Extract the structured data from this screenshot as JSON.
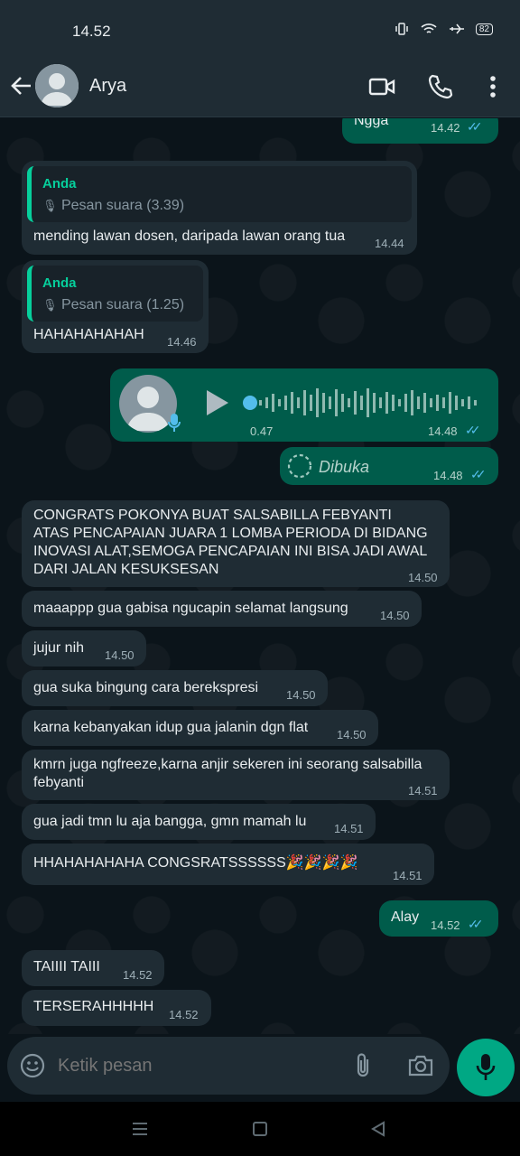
{
  "status": {
    "time": "14.52",
    "battery": "82"
  },
  "header": {
    "contact_name": "Arya"
  },
  "messages": {
    "m0": {
      "text": "Ngga",
      "time": "14.42"
    },
    "m1": {
      "quote_author": "Anda",
      "quote_text": "Pesan suara (3.39)",
      "text": "mending lawan dosen, daripada lawan orang tua",
      "time": "14.44"
    },
    "m2": {
      "quote_author": "Anda",
      "quote_text": "Pesan suara (1.25)",
      "text": "HAHAHAHAHAH",
      "time": "14.46"
    },
    "m3": {
      "duration": "0.47",
      "time": "14.48"
    },
    "m4": {
      "text": "Dibuka",
      "time": "14.48"
    },
    "m5": {
      "line1": "CONGRATS POKONYA BUAT SALSABILLA FEBYANTI",
      "line2": "ATAS PENCAPAIAN JUARA 1 LOMBA PERIODA DI BIDANG",
      "line3": "INOVASI ALAT,SEMOGA PENCAPAIAN INI BISA JADI AWAL",
      "line4": "DARI JALAN KESUKSESAN",
      "time": "14.50"
    },
    "m6": {
      "text": "maaappp gua gabisa ngucapin selamat langsung",
      "time": "14.50"
    },
    "m7": {
      "text": "jujur nih",
      "time": "14.50"
    },
    "m8": {
      "text": "gua suka bingung cara berekspresi",
      "time": "14.50"
    },
    "m9": {
      "text": "karna kebanyakan idup gua jalanin dgn flat",
      "time": "14.50"
    },
    "m10": {
      "line1": "kmrn juga ngfreeze,karna anjir sekeren ini seorang salsabilla",
      "line2": "febyanti",
      "time": "14.51"
    },
    "m11": {
      "text": "gua jadi tmn lu aja bangga, gmn mamah lu",
      "time": "14.51"
    },
    "m12": {
      "text": "HHAHAHAHAHA CONGSRATSSSSSS🎉🎉🎉🎉",
      "time": "14.51"
    },
    "m13": {
      "text": "Alay",
      "time": "14.52"
    },
    "m14": {
      "text": "TAIIII TAIII",
      "time": "14.52"
    },
    "m15": {
      "text": "TERSERAHHHHH",
      "time": "14.52"
    }
  },
  "composer": {
    "placeholder": "Ketik pesan"
  },
  "colors": {
    "accent": "#00a884",
    "outgoing": "#005c4b",
    "incoming": "#1f2c34",
    "read_tick": "#53bdeb"
  }
}
